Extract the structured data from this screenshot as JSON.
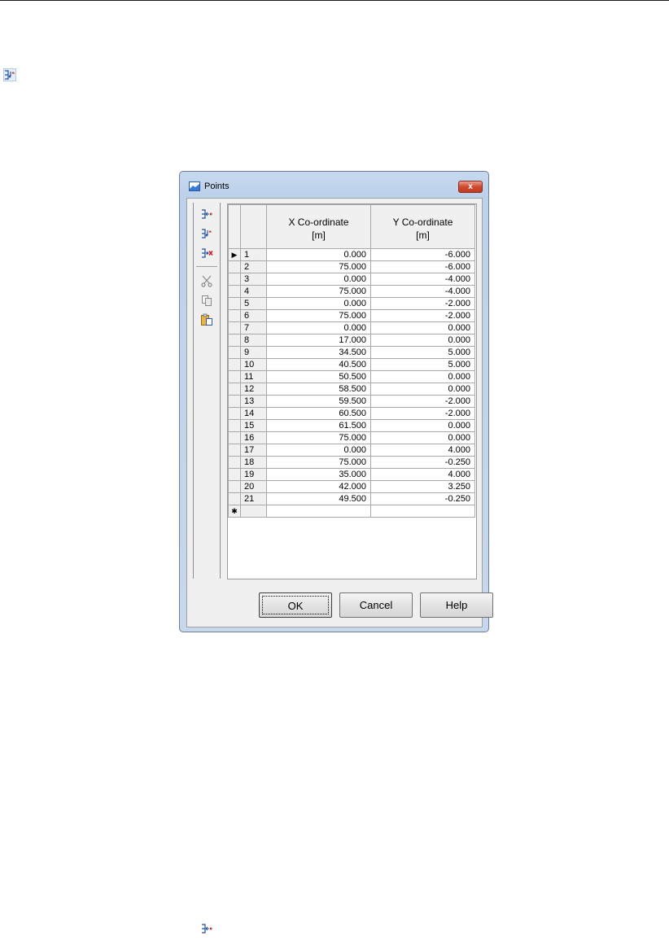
{
  "dialog": {
    "title": "Points",
    "close_symbol": "x",
    "toolbar": {
      "buttons": [
        {
          "name": "add-row-icon"
        },
        {
          "name": "insert-row-icon"
        },
        {
          "name": "delete-row-icon"
        },
        {
          "name": "cut-icon"
        },
        {
          "name": "copy-icon"
        },
        {
          "name": "paste-icon"
        }
      ]
    },
    "table": {
      "columns": {
        "x": {
          "line1": "X Co-ordinate",
          "line2": "[m]"
        },
        "y": {
          "line1": "Y Co-ordinate",
          "line2": "[m]"
        }
      },
      "current_row_marker": "▶",
      "new_row_marker": "✱",
      "rows": [
        {
          "num": "1",
          "x": "0.000",
          "y": "-6.000"
        },
        {
          "num": "2",
          "x": "75.000",
          "y": "-6.000"
        },
        {
          "num": "3",
          "x": "0.000",
          "y": "-4.000"
        },
        {
          "num": "4",
          "x": "75.000",
          "y": "-4.000"
        },
        {
          "num": "5",
          "x": "0.000",
          "y": "-2.000"
        },
        {
          "num": "6",
          "x": "75.000",
          "y": "-2.000"
        },
        {
          "num": "7",
          "x": "0.000",
          "y": "0.000"
        },
        {
          "num": "8",
          "x": "17.000",
          "y": "0.000"
        },
        {
          "num": "9",
          "x": "34.500",
          "y": "5.000"
        },
        {
          "num": "10",
          "x": "40.500",
          "y": "5.000"
        },
        {
          "num": "11",
          "x": "50.500",
          "y": "0.000"
        },
        {
          "num": "12",
          "x": "58.500",
          "y": "0.000"
        },
        {
          "num": "13",
          "x": "59.500",
          "y": "-2.000"
        },
        {
          "num": "14",
          "x": "60.500",
          "y": "-2.000"
        },
        {
          "num": "15",
          "x": "61.500",
          "y": "0.000"
        },
        {
          "num": "16",
          "x": "75.000",
          "y": "0.000"
        },
        {
          "num": "17",
          "x": "0.000",
          "y": "4.000"
        },
        {
          "num": "18",
          "x": "75.000",
          "y": "-0.250"
        },
        {
          "num": "19",
          "x": "35.000",
          "y": "4.000"
        },
        {
          "num": "20",
          "x": "42.000",
          "y": "3.250"
        },
        {
          "num": "21",
          "x": "49.500",
          "y": "-0.250"
        }
      ]
    },
    "buttons": {
      "ok": "OK",
      "cancel": "Cancel",
      "help": "Help"
    }
  },
  "document_icons": [
    {
      "name": "insert-row-icon"
    },
    {
      "name": "add-row-icon"
    }
  ]
}
